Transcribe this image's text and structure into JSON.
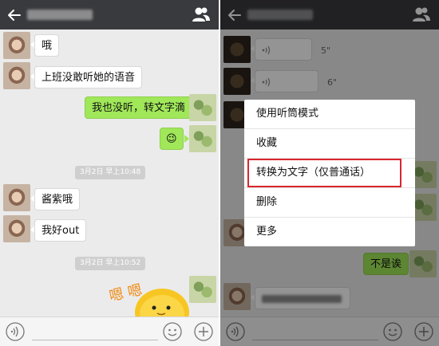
{
  "left": {
    "messages": [
      {
        "text": "哦"
      },
      {
        "text": "上班没敢听她的语音"
      },
      {
        "text": "我也没听，转文字滴"
      },
      {
        "text": "😉"
      },
      {
        "text": "酱紫哦"
      },
      {
        "text": "我好out"
      }
    ],
    "timestamps": [
      "3月2日 早上10:48",
      "3月2日 早上10:52"
    ],
    "sticker_text": "嗯 嗯"
  },
  "right": {
    "voice_messages": [
      {
        "duration": "5\""
      },
      {
        "duration": "6\""
      }
    ],
    "menu": {
      "items": [
        {
          "label": "使用听筒模式"
        },
        {
          "label": "收藏"
        },
        {
          "label": "转换为文字（仅普通话）"
        },
        {
          "label": "删除"
        },
        {
          "label": "更多"
        }
      ],
      "highlighted_item": "转换为文字（仅普通话）"
    },
    "out_message": "不是诶"
  },
  "colors": {
    "titlebar": "#393a3e",
    "chat_bg": "#ebebeb",
    "out_bubble": "#a0e759",
    "highlight": "#d8272d"
  },
  "icons": [
    "back-arrow-icon",
    "contacts-icon",
    "voice-input-icon",
    "emoji-icon",
    "plus-icon"
  ]
}
